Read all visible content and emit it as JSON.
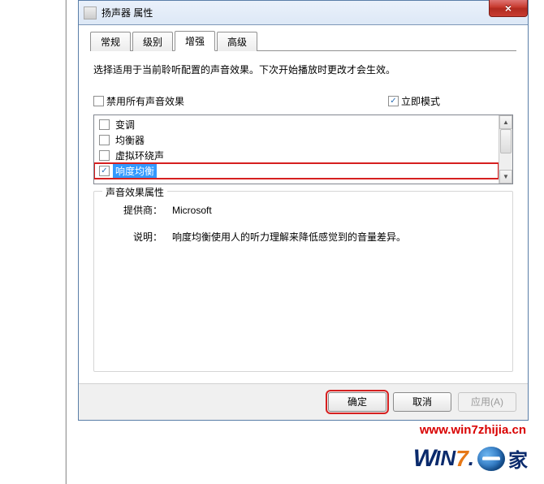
{
  "window": {
    "title": "扬声器 属性",
    "close_glyph": "×"
  },
  "tabs": [
    "常规",
    "级别",
    "增强",
    "高级"
  ],
  "active_tab_index": 2,
  "description": "选择适用于当前聆听配置的声音效果。下次开始播放时更改才会生效。",
  "disable_all": {
    "label": "禁用所有声音效果",
    "checked": false
  },
  "immediate": {
    "label": "立即模式",
    "checked": true
  },
  "effects": [
    {
      "label": "变调",
      "checked": false,
      "selected": false
    },
    {
      "label": "均衡器",
      "checked": false,
      "selected": false
    },
    {
      "label": "虚拟环绕声",
      "checked": false,
      "selected": false
    },
    {
      "label": "响度均衡",
      "checked": true,
      "selected": true
    }
  ],
  "properties": {
    "group_title": "声音效果属性",
    "provider_label": "提供商：",
    "provider_value": "Microsoft",
    "desc_label": "说明：",
    "desc_value": "响度均衡使用人的听力理解来降低感觉到的音量差异。"
  },
  "buttons": {
    "ok": "确定",
    "cancel": "取消",
    "apply": "应用(A)"
  },
  "watermark": "www.win7zhijia.cn",
  "logo": {
    "w": "W",
    "in": "IN",
    "seven": "7",
    "dot": ".",
    "jia": "家"
  },
  "scroll": {
    "up": "▲",
    "down": "▼"
  }
}
